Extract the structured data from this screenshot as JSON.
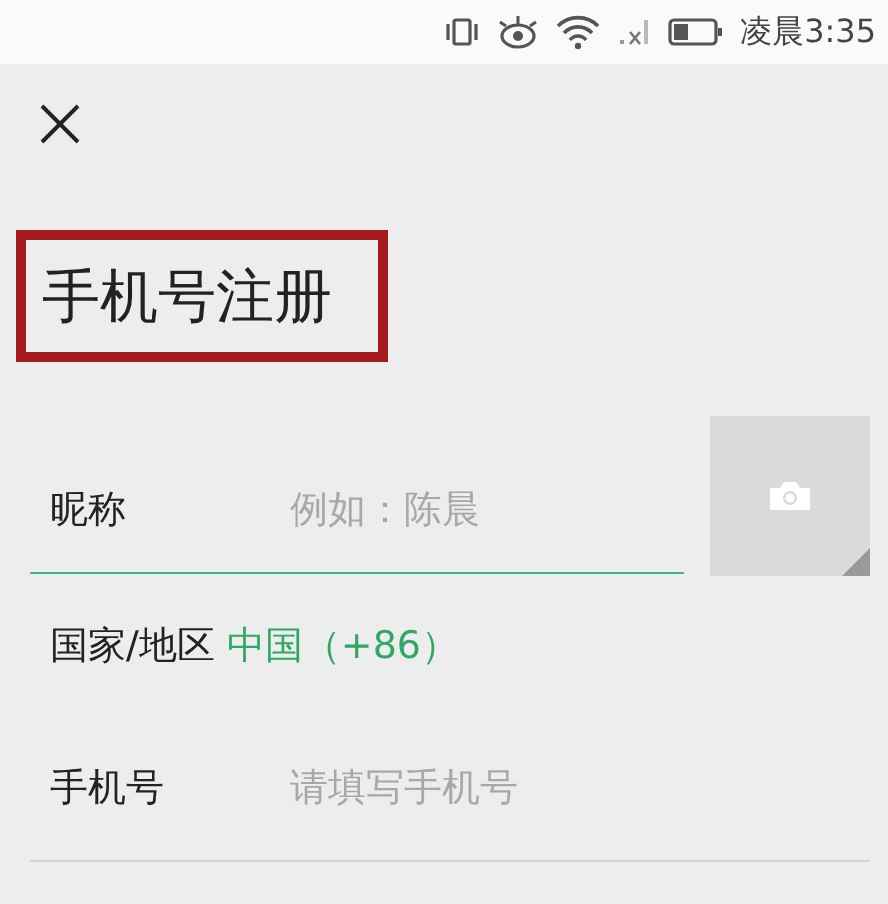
{
  "status_bar": {
    "time": "凌晨3:35"
  },
  "title": "手机号注册",
  "form": {
    "nickname": {
      "label": "昵称",
      "placeholder": "例如：陈晨"
    },
    "country": {
      "label": "国家/地区",
      "value": "中国（+86）"
    },
    "phone": {
      "label": "手机号",
      "placeholder": "请填写手机号"
    }
  }
}
